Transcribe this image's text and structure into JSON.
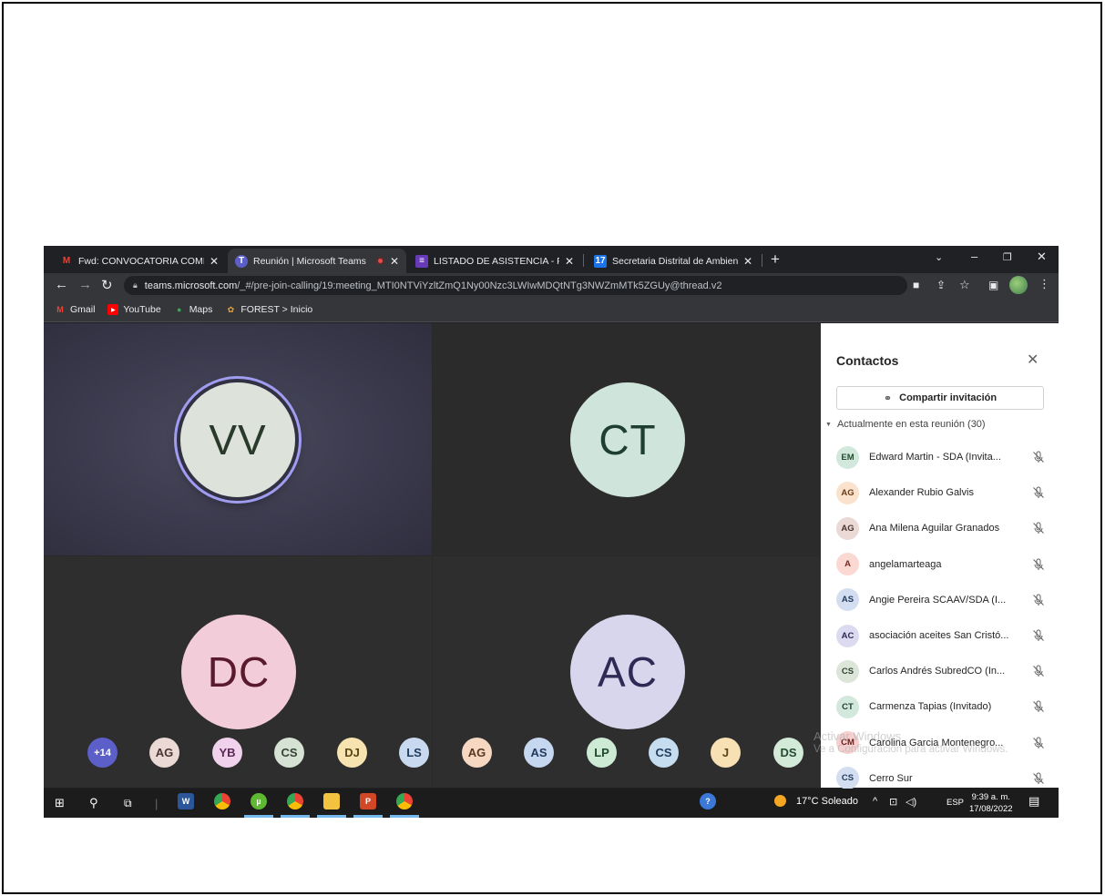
{
  "browser": {
    "tabs": [
      {
        "label": "Fwd: CONVOCATORIA COMISIÓN",
        "favicon": "gmail-icon"
      },
      {
        "label": "Reunión | Microsoft Teams",
        "favicon": "teams-icon"
      },
      {
        "label": "LISTADO DE ASISTENCIA - PARTI",
        "favicon": "forms-icon"
      },
      {
        "label": "Secretaria Distrital de Ambiente",
        "favicon": "calendar-icon"
      }
    ],
    "url_host": "teams.microsoft.com",
    "url_path": "/_#/pre-join-calling/19:meeting_MTI0NTViYzltZmQ1Ny00Nzc3LWIwMDQtNTg3NWZmMTk5ZGUy@thread.v2",
    "bookmarks": [
      "Gmail",
      "YouTube",
      "Maps",
      "FOREST > Inicio"
    ]
  },
  "meeting": {
    "tiles": [
      {
        "initials": "VV",
        "bg": "#dde3da",
        "fg": "#2a3a2a",
        "speaking": true
      },
      {
        "initials": "CT",
        "bg": "#cfe4da",
        "fg": "#1f3e33"
      },
      {
        "initials": "DC",
        "bg": "#f2cdd9",
        "fg": "#5a1a2e"
      },
      {
        "initials": "AC",
        "bg": "#d8d6ec",
        "fg": "#2e2a55"
      }
    ],
    "overflow_count": "+14",
    "strip": [
      {
        "initials": "AG",
        "bg": "#ead9d4",
        "fg": "#4a3430"
      },
      {
        "initials": "YB",
        "bg": "#f0d2ec",
        "fg": "#5a2a55"
      },
      {
        "initials": "CS",
        "bg": "#d6e2d4",
        "fg": "#334433"
      },
      {
        "initials": "DJ",
        "bg": "#f7e3b0",
        "fg": "#5a4415"
      },
      {
        "initials": "LS",
        "bg": "#c9d9ef",
        "fg": "#1f3a5c"
      },
      {
        "initials": "AG",
        "bg": "#f6d8c2",
        "fg": "#5a3820"
      },
      {
        "initials": "AS",
        "bg": "#c6d8ef",
        "fg": "#1f3a5c"
      },
      {
        "initials": "LP",
        "bg": "#cdebd4",
        "fg": "#1f4a2a"
      },
      {
        "initials": "CS",
        "bg": "#c6dcef",
        "fg": "#1f3a5c"
      },
      {
        "initials": "J",
        "bg": "#f7e0b4",
        "fg": "#5a4415"
      },
      {
        "initials": "DS",
        "bg": "#d3ead9",
        "fg": "#244a30"
      }
    ]
  },
  "panel": {
    "title": "Contactos",
    "share_label": "Compartir invitación",
    "section_label": "Actualmente en esta reunión (30)",
    "participants": [
      {
        "initials": "EM",
        "name": "Edward Martin - SDA (Invita...",
        "bg": "#d2e8dc",
        "fg": "#244a30"
      },
      {
        "initials": "AG",
        "name": "Alexander Rubio Galvis",
        "bg": "#fbe2cd",
        "fg": "#6a3c18"
      },
      {
        "initials": "AG",
        "name": "Ana Milena Aguilar Granados",
        "bg": "#ead9d4",
        "fg": "#4a3430"
      },
      {
        "initials": "A",
        "name": "angelamarteaga",
        "bg": "#fbd9d3",
        "fg": "#7a2a20"
      },
      {
        "initials": "AS",
        "name": "Angie Pereira SCAAV/SDA (I...",
        "bg": "#d3def0",
        "fg": "#1f3a5c"
      },
      {
        "initials": "AC",
        "name": "asociación aceites San Cristó...",
        "bg": "#dcdaf0",
        "fg": "#2e2a55"
      },
      {
        "initials": "CS",
        "name": "Carlos Andrés SubredCO (In...",
        "bg": "#dbe5d8",
        "fg": "#334433"
      },
      {
        "initials": "CT",
        "name": "Carmenza Tapias (Invitado)",
        "bg": "#d3e8dc",
        "fg": "#1f3e33"
      },
      {
        "initials": "CM",
        "name": "Carolina Garcia Montenegro...",
        "bg": "#f6cfcf",
        "fg": "#6a2020"
      },
      {
        "initials": "CS",
        "name": "Cerro Sur",
        "bg": "#d3def0",
        "fg": "#1f3a5c"
      }
    ]
  },
  "watermark": {
    "line1": "Activar Windows",
    "line2": "Ve a Configuración para activar Windows."
  },
  "taskbar": {
    "weather": "17°C  Soleado",
    "lang": "ESP",
    "time": "9:39 a. m.",
    "date": "17/08/2022"
  }
}
